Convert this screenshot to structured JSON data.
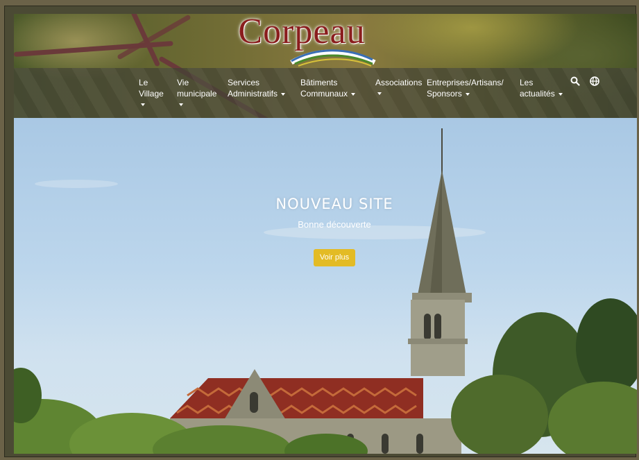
{
  "site": {
    "logo_text": "Corpeau"
  },
  "nav": {
    "items": [
      {
        "line1": "Le",
        "line2": "Village",
        "caret": "below"
      },
      {
        "line1": "Vie",
        "line2": "municipale",
        "caret": "below"
      },
      {
        "line1": "Services",
        "line2": "Administratifs",
        "caret": "inline"
      },
      {
        "line1": "Bâtiments",
        "line2": "Communaux",
        "caret": "inline"
      },
      {
        "line1": "Associations",
        "line2": "",
        "caret": "below"
      },
      {
        "line1": "Entreprises/Artisans/",
        "line2": "Sponsors",
        "caret": "inline"
      },
      {
        "line1": "Les",
        "line2": "actualités",
        "caret": "inline"
      }
    ],
    "search_icon": "search-icon",
    "language_icon": "globe-icon"
  },
  "hero": {
    "title": "NOUVEAU SITE",
    "subtitle": "Bonne découverte",
    "button_label": "Voir plus",
    "button_color": "#e3bb25"
  },
  "colors": {
    "logo_red": "#8a1d1d",
    "nav_text": "#ffffff"
  }
}
